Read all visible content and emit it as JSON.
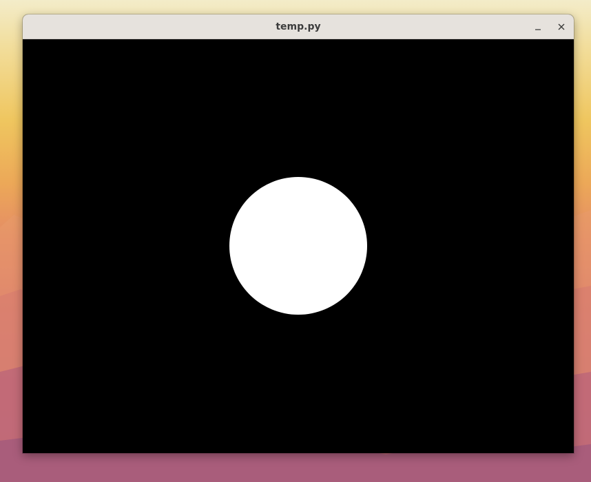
{
  "window": {
    "title": "temp.py",
    "minimize_icon": "minimize-icon",
    "close_icon": "close-icon"
  },
  "canvas": {
    "background_color": "#000000",
    "shape": "circle",
    "shape_color": "#ffffff"
  },
  "desktop": {
    "wallpaper": "sunset-mountains"
  }
}
